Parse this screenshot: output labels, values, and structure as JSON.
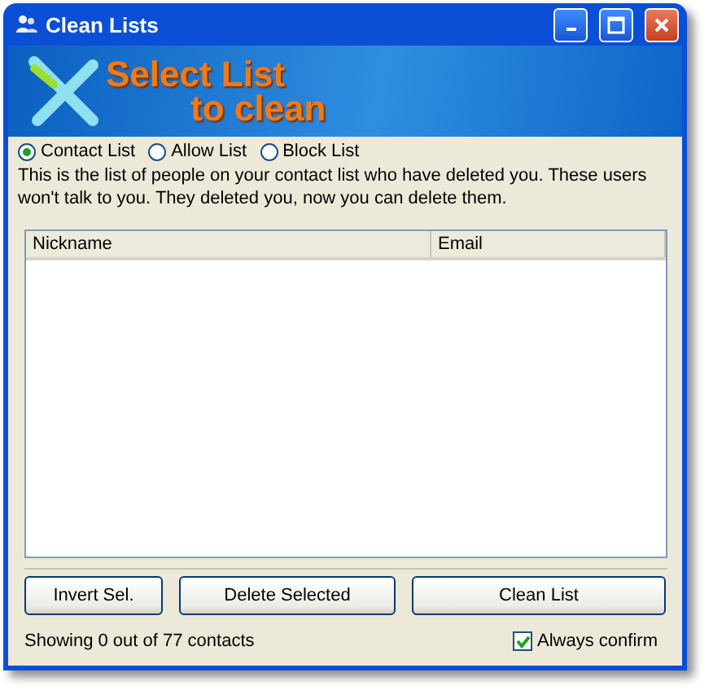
{
  "window": {
    "title": "Clean Lists"
  },
  "banner": {
    "line_1": "Select List",
    "line_2": "to clean"
  },
  "list_choice": [
    {
      "label": "Contact List",
      "selected": true
    },
    {
      "label": "Allow List",
      "selected": false
    },
    {
      "label": "Block List",
      "selected": false
    }
  ],
  "description": "This is the list of people on your contact list who have deleted you. These users won't talk to you. They deleted you, now you can delete them.",
  "table": {
    "columns": [
      "Nickname",
      "Email"
    ]
  },
  "buttons": [
    "Invert Sel.",
    "Delete Selected",
    "Clean List"
  ],
  "status": "Showing 0 out of 77 contacts",
  "always_confirm": {
    "label": "Always confirm",
    "checked": true
  }
}
